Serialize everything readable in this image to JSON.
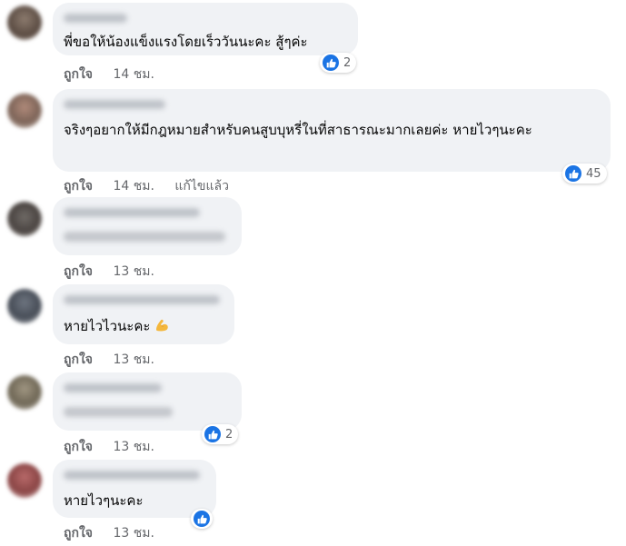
{
  "comments": [
    {
      "text": "พี่ขอให้น้องแข็งแรงโดยเร็ววันนะคะ สู้ๆค่ะ",
      "like_label": "ถูกใจ",
      "time": "14 ชม.",
      "reaction_count": "2"
    },
    {
      "text": "จริงๆอยากให้มีกฎหมายสำหรับคนสูบบุหรี่ในที่สาธารณะมากเลยค่ะ หายไวๆนะคะ",
      "like_label": "ถูกใจ",
      "time": "14 ชม.",
      "edited": "แก้ไขแล้ว",
      "reaction_count": "45"
    },
    {
      "text": "",
      "like_label": "ถูกใจ",
      "time": "13 ชม."
    },
    {
      "text": "หายไวไวนะคะ",
      "emoji_icon": "flexed-biceps-icon",
      "like_label": "ถูกใจ",
      "time": "13 ชม."
    },
    {
      "text": "",
      "like_label": "ถูกใจ",
      "time": "13 ชม.",
      "reaction_count": "2"
    },
    {
      "text": "หายไวๆนะคะ",
      "like_label": "ถูกใจ",
      "time": "13 ชม.",
      "reaction_count": ""
    }
  ],
  "colors": {
    "bubble_bg": "#f0f2f5",
    "meta_text": "#65676b",
    "like_blue": "#1b74e4"
  }
}
